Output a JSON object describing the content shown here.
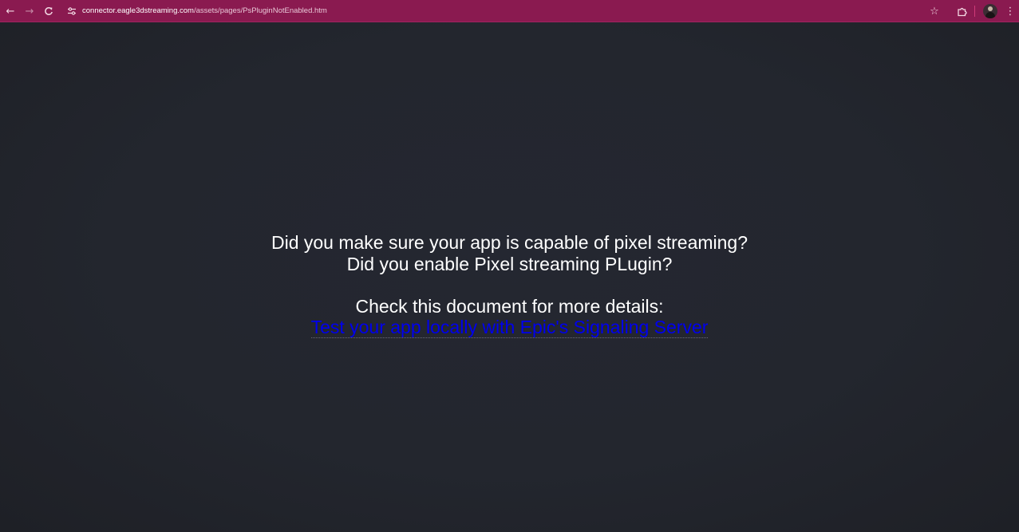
{
  "browser": {
    "url_host": "connector.eagle3dstreaming.com",
    "url_path": "/assets/pages/PsPluginNotEnabled.htm",
    "icons": {
      "back": "arrow-left-icon",
      "forward": "arrow-right-icon",
      "reload": "reload-icon",
      "site_info": "site-settings-icon",
      "bookmark": "star-icon",
      "extensions": "puzzle-icon",
      "profile": "avatar",
      "menu": "kebab-menu-icon"
    },
    "colors": {
      "toolbar_bg": "#8a1a50",
      "page_bg": "#22252c"
    }
  },
  "page": {
    "line1": "Did you make sure your app is capable of pixel streaming?",
    "line2": "Did you enable Pixel streaming PLugin?",
    "line3": "Check this document for more details:",
    "link_text": "Test your app locally with Epic's Signaling Server",
    "colors": {
      "text": "#ffffff",
      "link": "#0000ee"
    }
  }
}
